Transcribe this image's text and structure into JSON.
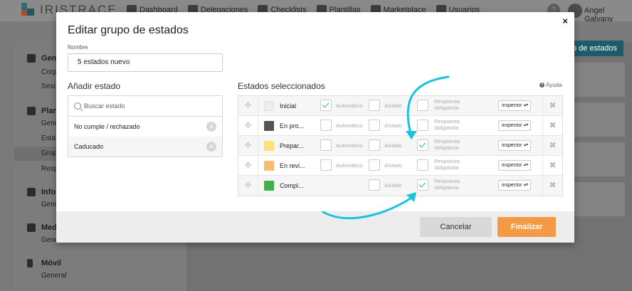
{
  "app": {
    "brand": "IRISTRACE",
    "nav": [
      {
        "label": "Dashboard",
        "icon": "dashboard-icon"
      },
      {
        "label": "Delegaciones",
        "icon": "building-icon"
      },
      {
        "label": "Checklists",
        "icon": "checklist-icon"
      },
      {
        "label": "Plantillas",
        "icon": "template-icon"
      },
      {
        "label": "Marketplace",
        "icon": "store-icon"
      },
      {
        "label": "Usuarios",
        "icon": "users-icon"
      }
    ],
    "help_glyph": "?",
    "user": "Angel Galvany",
    "action_button_label": "o de estados"
  },
  "sidebar": {
    "sections": [
      {
        "head": "Gene",
        "subs": [
          "Corp",
          "Sesi"
        ]
      },
      {
        "head": "Plan",
        "subs": [
          "Gene",
          "Esta",
          "Grup",
          "Resp"
        ]
      },
      {
        "head": "Info",
        "subs": [
          "Gene"
        ]
      },
      {
        "head": "Med",
        "subs": [
          "Gene"
        ]
      },
      {
        "head": "Móvil",
        "subs": [
          "General"
        ]
      }
    ]
  },
  "modal": {
    "title": "Editar grupo de estados",
    "close_glyph": "×",
    "name_label": "Nombre",
    "name_value": "5 estados nuevo",
    "add_title": "Añadir estado",
    "search_placeholder": "Buscar estado",
    "available": [
      "No cumple / rechazado",
      "Caducado"
    ],
    "plus_glyph": "+",
    "selected_title": "Estados seleccionados",
    "help_label": "Ayuda",
    "labels": {
      "automatico": "Automático",
      "aislado": "Aislado",
      "respuesta_1": "Respuesta",
      "respuesta_2": "obligatoria"
    },
    "states": [
      {
        "name": "Inicial",
        "color": "#eeeeee",
        "automatico": true,
        "aislado": false,
        "respuesta": false,
        "has_auto": true,
        "role": "inspector"
      },
      {
        "name": "En pro...",
        "color": "#555555",
        "automatico": false,
        "aislado": false,
        "respuesta": false,
        "has_auto": true,
        "role": "inspector"
      },
      {
        "name": "Prepar...",
        "color": "#fde377",
        "automatico": false,
        "aislado": false,
        "respuesta": true,
        "has_auto": true,
        "role": "inspector"
      },
      {
        "name": "En revi...",
        "color": "#f7bb71",
        "automatico": false,
        "aislado": false,
        "respuesta": false,
        "has_auto": true,
        "role": "inspector"
      },
      {
        "name": "Compl...",
        "color": "#3cb34a",
        "automatico": false,
        "aislado": false,
        "respuesta": true,
        "has_auto": false,
        "role": "inspector"
      }
    ],
    "drag_glyph": "✥",
    "delete_glyph": "✖",
    "select_arrow": "▴▾",
    "cancel_label": "Cancelar",
    "finalize_label": "Finalizar"
  },
  "colors": {
    "accent": "#20b9c8",
    "primary": "#f49a45"
  }
}
